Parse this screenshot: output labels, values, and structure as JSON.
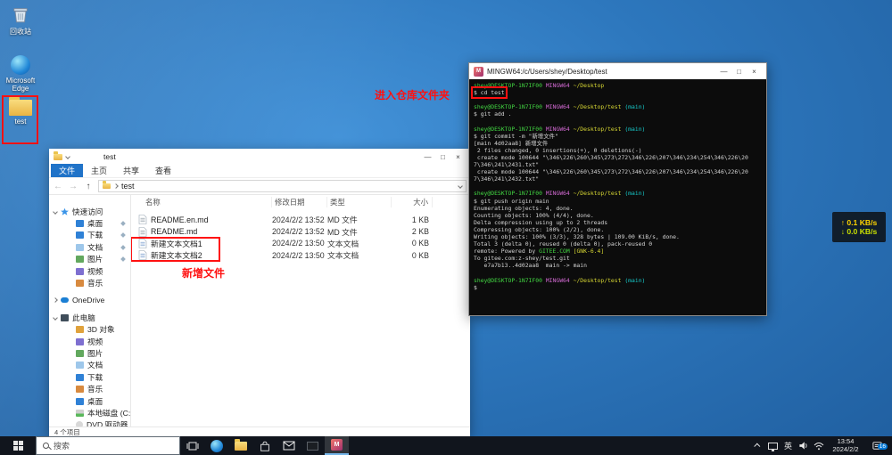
{
  "desktop_icons": [
    {
      "label": "回收站"
    },
    {
      "label": "Microsoft Edge"
    },
    {
      "label": "test"
    }
  ],
  "annotations": {
    "enter_repo_label": "进入仓库文件夹",
    "new_files_label": "新增文件",
    "accent_color": "#ff1111"
  },
  "explorer": {
    "window_title": "test",
    "menu_items": [
      "文件",
      "主页",
      "共享",
      "查看"
    ],
    "breadcrumb": "test",
    "columns": [
      "名称",
      "修改日期",
      "类型",
      "大小"
    ],
    "files": [
      {
        "icon": "md",
        "name": "README.en.md",
        "date": "2024/2/2 13:52",
        "type": "MD 文件",
        "size": "1 KB"
      },
      {
        "icon": "md",
        "name": "README.md",
        "date": "2024/2/2 13:52",
        "type": "MD 文件",
        "size": "2 KB"
      },
      {
        "icon": "txt",
        "name": "新建文本文档1",
        "date": "2024/2/2 13:50",
        "type": "文本文档",
        "size": "0 KB"
      },
      {
        "icon": "txt",
        "name": "新建文本文档2",
        "date": "2024/2/2 13:50",
        "type": "文本文档",
        "size": "0 KB"
      }
    ],
    "sidebar": [
      {
        "label": "快速访问",
        "level": 0,
        "icon": "star",
        "expander": "v"
      },
      {
        "label": "桌面",
        "level": 1,
        "icon": "desktop",
        "pin": true
      },
      {
        "label": "下载",
        "level": 1,
        "icon": "download",
        "pin": true
      },
      {
        "label": "文档",
        "level": 1,
        "icon": "doc",
        "pin": true
      },
      {
        "label": "图片",
        "level": 1,
        "icon": "pic",
        "pin": true
      },
      {
        "label": "视频",
        "level": 1,
        "icon": "video"
      },
      {
        "label": "音乐",
        "level": 1,
        "icon": "music"
      },
      {
        "label": "OneDrive",
        "level": 0,
        "icon": "cloud",
        "expander": ">",
        "gap": true
      },
      {
        "label": "此电脑",
        "level": 0,
        "icon": "pc",
        "expander": "v",
        "gap": true
      },
      {
        "label": "3D 对象",
        "level": 1,
        "icon": "obj"
      },
      {
        "label": "视频",
        "level": 1,
        "icon": "video"
      },
      {
        "label": "图片",
        "level": 1,
        "icon": "pic"
      },
      {
        "label": "文档",
        "level": 1,
        "icon": "doc"
      },
      {
        "label": "下载",
        "level": 1,
        "icon": "download"
      },
      {
        "label": "音乐",
        "level": 1,
        "icon": "music"
      },
      {
        "label": "桌面",
        "level": 1,
        "icon": "desktop"
      },
      {
        "label": "本地磁盘 (C:)",
        "level": 1,
        "icon": "disk"
      },
      {
        "label": "DVD 驱动器 (D:) E",
        "level": 1,
        "icon": "dvd"
      }
    ],
    "status_text": "4 个项目"
  },
  "terminal": {
    "window_title": "MINGW64:/c/Users/shey/Desktop/test",
    "lines": [
      {
        "segs": [
          {
            "t": "shey@DESKTOP-1N7IF00 ",
            "c": "g"
          },
          {
            "t": "MINGW64 ",
            "c": "p"
          },
          {
            "t": "~/Desktop",
            "c": "y"
          }
        ]
      },
      {
        "segs": [
          {
            "t": "$ cd test",
            "c": "w"
          }
        ],
        "boxed": true
      },
      {
        "segs": []
      },
      {
        "segs": [
          {
            "t": "shey@DESKTOP-1N7IF00 ",
            "c": "g"
          },
          {
            "t": "MINGW64 ",
            "c": "p"
          },
          {
            "t": "~/Desktop/test ",
            "c": "y"
          },
          {
            "t": "(main)",
            "c": "c"
          }
        ]
      },
      {
        "segs": [
          {
            "t": "$ git add .",
            "c": "w"
          }
        ]
      },
      {
        "segs": []
      },
      {
        "segs": [
          {
            "t": "shey@DESKTOP-1N7IF00 ",
            "c": "g"
          },
          {
            "t": "MINGW64 ",
            "c": "p"
          },
          {
            "t": "~/Desktop/test ",
            "c": "y"
          },
          {
            "t": "(main)",
            "c": "c"
          }
        ]
      },
      {
        "segs": [
          {
            "t": "$ git commit -m \"新增文件\"",
            "c": "w"
          }
        ]
      },
      {
        "segs": [
          {
            "t": "[main 4d02aa8] 新增文件",
            "c": "w"
          }
        ]
      },
      {
        "segs": [
          {
            "t": " 2 files changed, 0 insertions(+), 0 deletions(-)",
            "c": "w"
          }
        ]
      },
      {
        "segs": [
          {
            "t": " create mode 100644 \"\\346\\226\\260\\345\\273\\272\\346\\226\\207\\346\\234\\254\\346\\226\\20",
            "c": "w"
          }
        ]
      },
      {
        "segs": [
          {
            "t": "7\\346\\241\\2431.txt\"",
            "c": "w"
          }
        ]
      },
      {
        "segs": [
          {
            "t": " create mode 100644 \"\\346\\226\\260\\345\\273\\272\\346\\226\\207\\346\\234\\254\\346\\226\\20",
            "c": "w"
          }
        ]
      },
      {
        "segs": [
          {
            "t": "7\\346\\241\\2432.txt\"",
            "c": "w"
          }
        ]
      },
      {
        "segs": []
      },
      {
        "segs": [
          {
            "t": "shey@DESKTOP-1N7IF00 ",
            "c": "g"
          },
          {
            "t": "MINGW64 ",
            "c": "p"
          },
          {
            "t": "~/Desktop/test ",
            "c": "y"
          },
          {
            "t": "(main)",
            "c": "c"
          }
        ]
      },
      {
        "segs": [
          {
            "t": "$ git push origin main",
            "c": "w"
          }
        ]
      },
      {
        "segs": [
          {
            "t": "Enumerating objects: 4, done.",
            "c": "w"
          }
        ]
      },
      {
        "segs": [
          {
            "t": "Counting objects: 100% (4/4), done.",
            "c": "w"
          }
        ]
      },
      {
        "segs": [
          {
            "t": "Delta compression using up to 2 threads",
            "c": "w"
          }
        ]
      },
      {
        "segs": [
          {
            "t": "Compressing objects: 100% (2/2), done.",
            "c": "w"
          }
        ]
      },
      {
        "segs": [
          {
            "t": "Writing objects: 100% (3/3), 328 bytes | 109.00 KiB/s, done.",
            "c": "w"
          }
        ]
      },
      {
        "segs": [
          {
            "t": "Total 3 (delta 0), reused 0 (delta 0), pack-reused 0",
            "c": "w"
          }
        ]
      },
      {
        "segs": [
          {
            "t": "remote: Powered by ",
            "c": "w"
          },
          {
            "t": "GITEE.COM ",
            "c": "g"
          },
          {
            "t": "[GNK-6.4]",
            "c": "y"
          }
        ]
      },
      {
        "segs": [
          {
            "t": "To gitee.com:z-shey/test.git",
            "c": "w"
          }
        ]
      },
      {
        "segs": [
          {
            "t": "   e7a7b13..4d02aa8  main -> main",
            "c": "w"
          }
        ]
      },
      {
        "segs": []
      },
      {
        "segs": [
          {
            "t": "shey@DESKTOP-1N7IF00 ",
            "c": "g"
          },
          {
            "t": "MINGW64 ",
            "c": "p"
          },
          {
            "t": "~/Desktop/test ",
            "c": "y"
          },
          {
            "t": "(main)",
            "c": "c"
          }
        ]
      },
      {
        "segs": [
          {
            "t": "$",
            "c": "w"
          }
        ]
      }
    ]
  },
  "net_widget": {
    "up": "↑ 0.1 KB/s",
    "down": "↓ 0.0 KB/s"
  },
  "taskbar": {
    "search_placeholder": "搜索",
    "tray_lang": "英",
    "clock_time": "13:54",
    "clock_date": "2024/2/2",
    "notif_count": "16"
  }
}
